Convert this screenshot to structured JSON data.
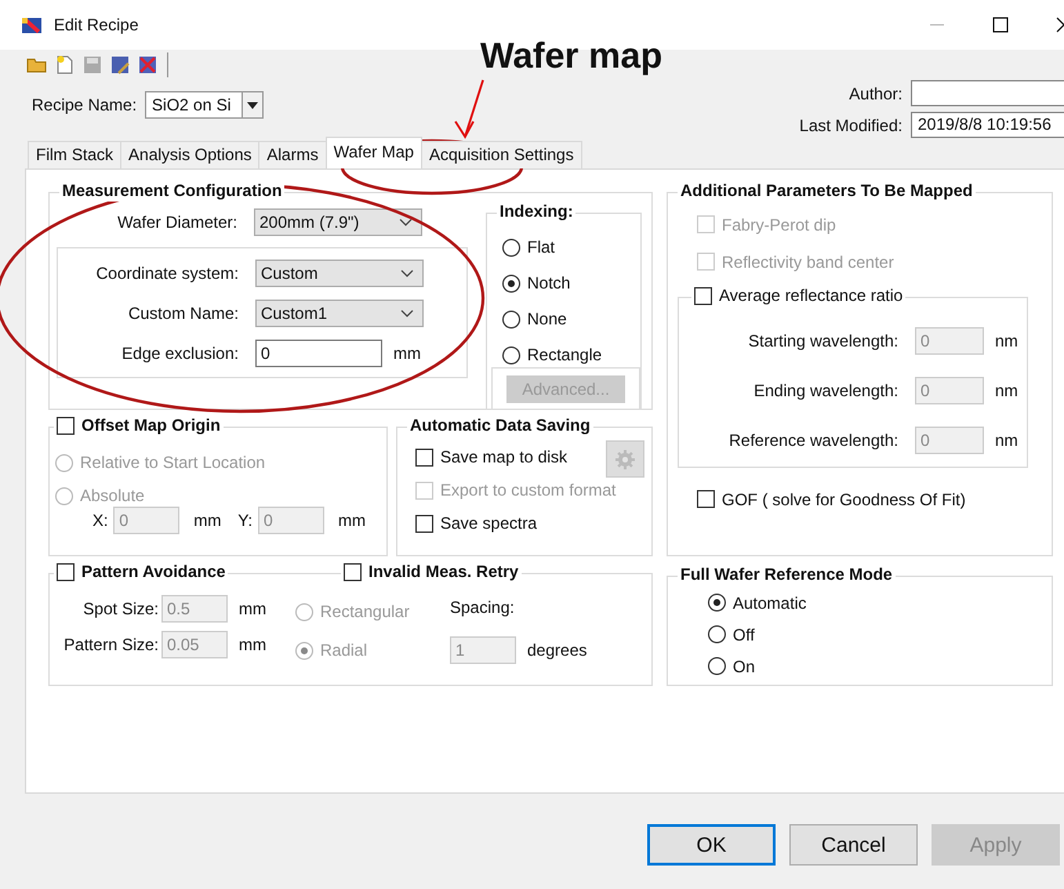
{
  "window": {
    "title": "Edit Recipe"
  },
  "annotation": {
    "text": "Wafer map"
  },
  "recipe_name": {
    "label": "Recipe Name:",
    "value": "SiO2 on Si"
  },
  "author": {
    "label": "Author:"
  },
  "last_modified": {
    "label": "Last Modified:",
    "value": "2019/8/8 10:19:56"
  },
  "tabs": [
    {
      "label": "Film Stack",
      "selected": false
    },
    {
      "label": "Analysis Options",
      "selected": false
    },
    {
      "label": "Alarms",
      "selected": false
    },
    {
      "label": "Wafer Map",
      "selected": true
    },
    {
      "label": "Acquisition Settings",
      "selected": false
    }
  ],
  "measurement": {
    "title": "Measurement Configuration",
    "wafer_diameter": {
      "label": "Wafer Diameter:",
      "value": "200mm (7.9\")"
    },
    "coordinate_system": {
      "label": "Coordinate system:",
      "value": "Custom"
    },
    "custom_name": {
      "label": "Custom Name:",
      "value": "Custom1"
    },
    "edge_exclusion": {
      "label": "Edge exclusion:",
      "value": "0",
      "unit": "mm"
    }
  },
  "indexing": {
    "title": "Indexing:",
    "options": [
      {
        "label": "Flat",
        "selected": false
      },
      {
        "label": "Notch",
        "selected": true
      },
      {
        "label": "None",
        "selected": false
      },
      {
        "label": "Rectangle",
        "selected": false
      }
    ],
    "advanced_button": {
      "label": "Advanced...",
      "disabled": true
    }
  },
  "offset_map_origin": {
    "label": "Offset Map Origin",
    "checked": false,
    "options": [
      {
        "label": "Relative to Start Location",
        "selected": false,
        "disabled": true
      },
      {
        "label": "Absolute",
        "selected": false,
        "disabled": true
      }
    ],
    "fields": [
      {
        "label": "X:",
        "value": "0",
        "unit": "mm",
        "disabled": true
      },
      {
        "label": "Y:",
        "value": "0",
        "unit": "mm",
        "disabled": true
      }
    ]
  },
  "data_saving": {
    "title": "Automatic Data Saving",
    "items": [
      {
        "label": "Save map to disk",
        "checked": false,
        "disabled": false
      },
      {
        "label": "Export to custom format",
        "checked": false,
        "disabled": true
      },
      {
        "label": "Save spectra",
        "checked": false,
        "disabled": false
      }
    ],
    "settings_button": {
      "disabled": true
    }
  },
  "pattern_avoidance": {
    "label": "Pattern Avoidance",
    "checked": false,
    "fields": [
      {
        "label": "Spot Size:",
        "value": "0.5",
        "unit": "mm",
        "disabled": true
      },
      {
        "label": "Pattern Size:",
        "value": "0.05",
        "unit": "mm",
        "disabled": true
      }
    ],
    "options": [
      {
        "label": "Rectangular",
        "selected": false,
        "disabled": true
      },
      {
        "label": "Radial",
        "selected": true,
        "disabled": true
      }
    ]
  },
  "invalid_meas_retry": {
    "label": "Invalid Meas. Retry",
    "checked": false,
    "spacing": {
      "label": "Spacing:",
      "value": "1",
      "unit": "degrees",
      "disabled": true
    }
  },
  "additional_parameters": {
    "title": "Additional Parameters To Be Mapped",
    "items": [
      {
        "label": "Fabry-Perot dip",
        "checked": false,
        "disabled": true
      },
      {
        "label": "Reflectivity band center",
        "checked": false,
        "disabled": true
      }
    ],
    "average_ratio": {
      "label": "Average reflectance ratio",
      "checked": false,
      "fields": [
        {
          "label": "Starting wavelength:",
          "value": "0",
          "unit": "nm",
          "disabled": true
        },
        {
          "label": "Ending wavelength:",
          "value": "0",
          "unit": "nm",
          "disabled": true
        },
        {
          "label": "Reference wavelength:",
          "value": "0",
          "unit": "nm",
          "disabled": true
        }
      ]
    },
    "gof": {
      "label": "GOF ( solve for Goodness Of Fit)",
      "checked": false
    }
  },
  "full_wafer_reference_mode": {
    "title": "Full Wafer Reference Mode",
    "options": [
      {
        "label": "Automatic",
        "selected": true
      },
      {
        "label": "Off",
        "selected": false
      },
      {
        "label": "On",
        "selected": false
      }
    ]
  },
  "buttons": [
    {
      "label": "OK",
      "kind": "default",
      "disabled": false
    },
    {
      "label": "Cancel",
      "kind": "normal",
      "disabled": false
    },
    {
      "label": "Apply",
      "kind": "normal",
      "disabled": true
    }
  ]
}
